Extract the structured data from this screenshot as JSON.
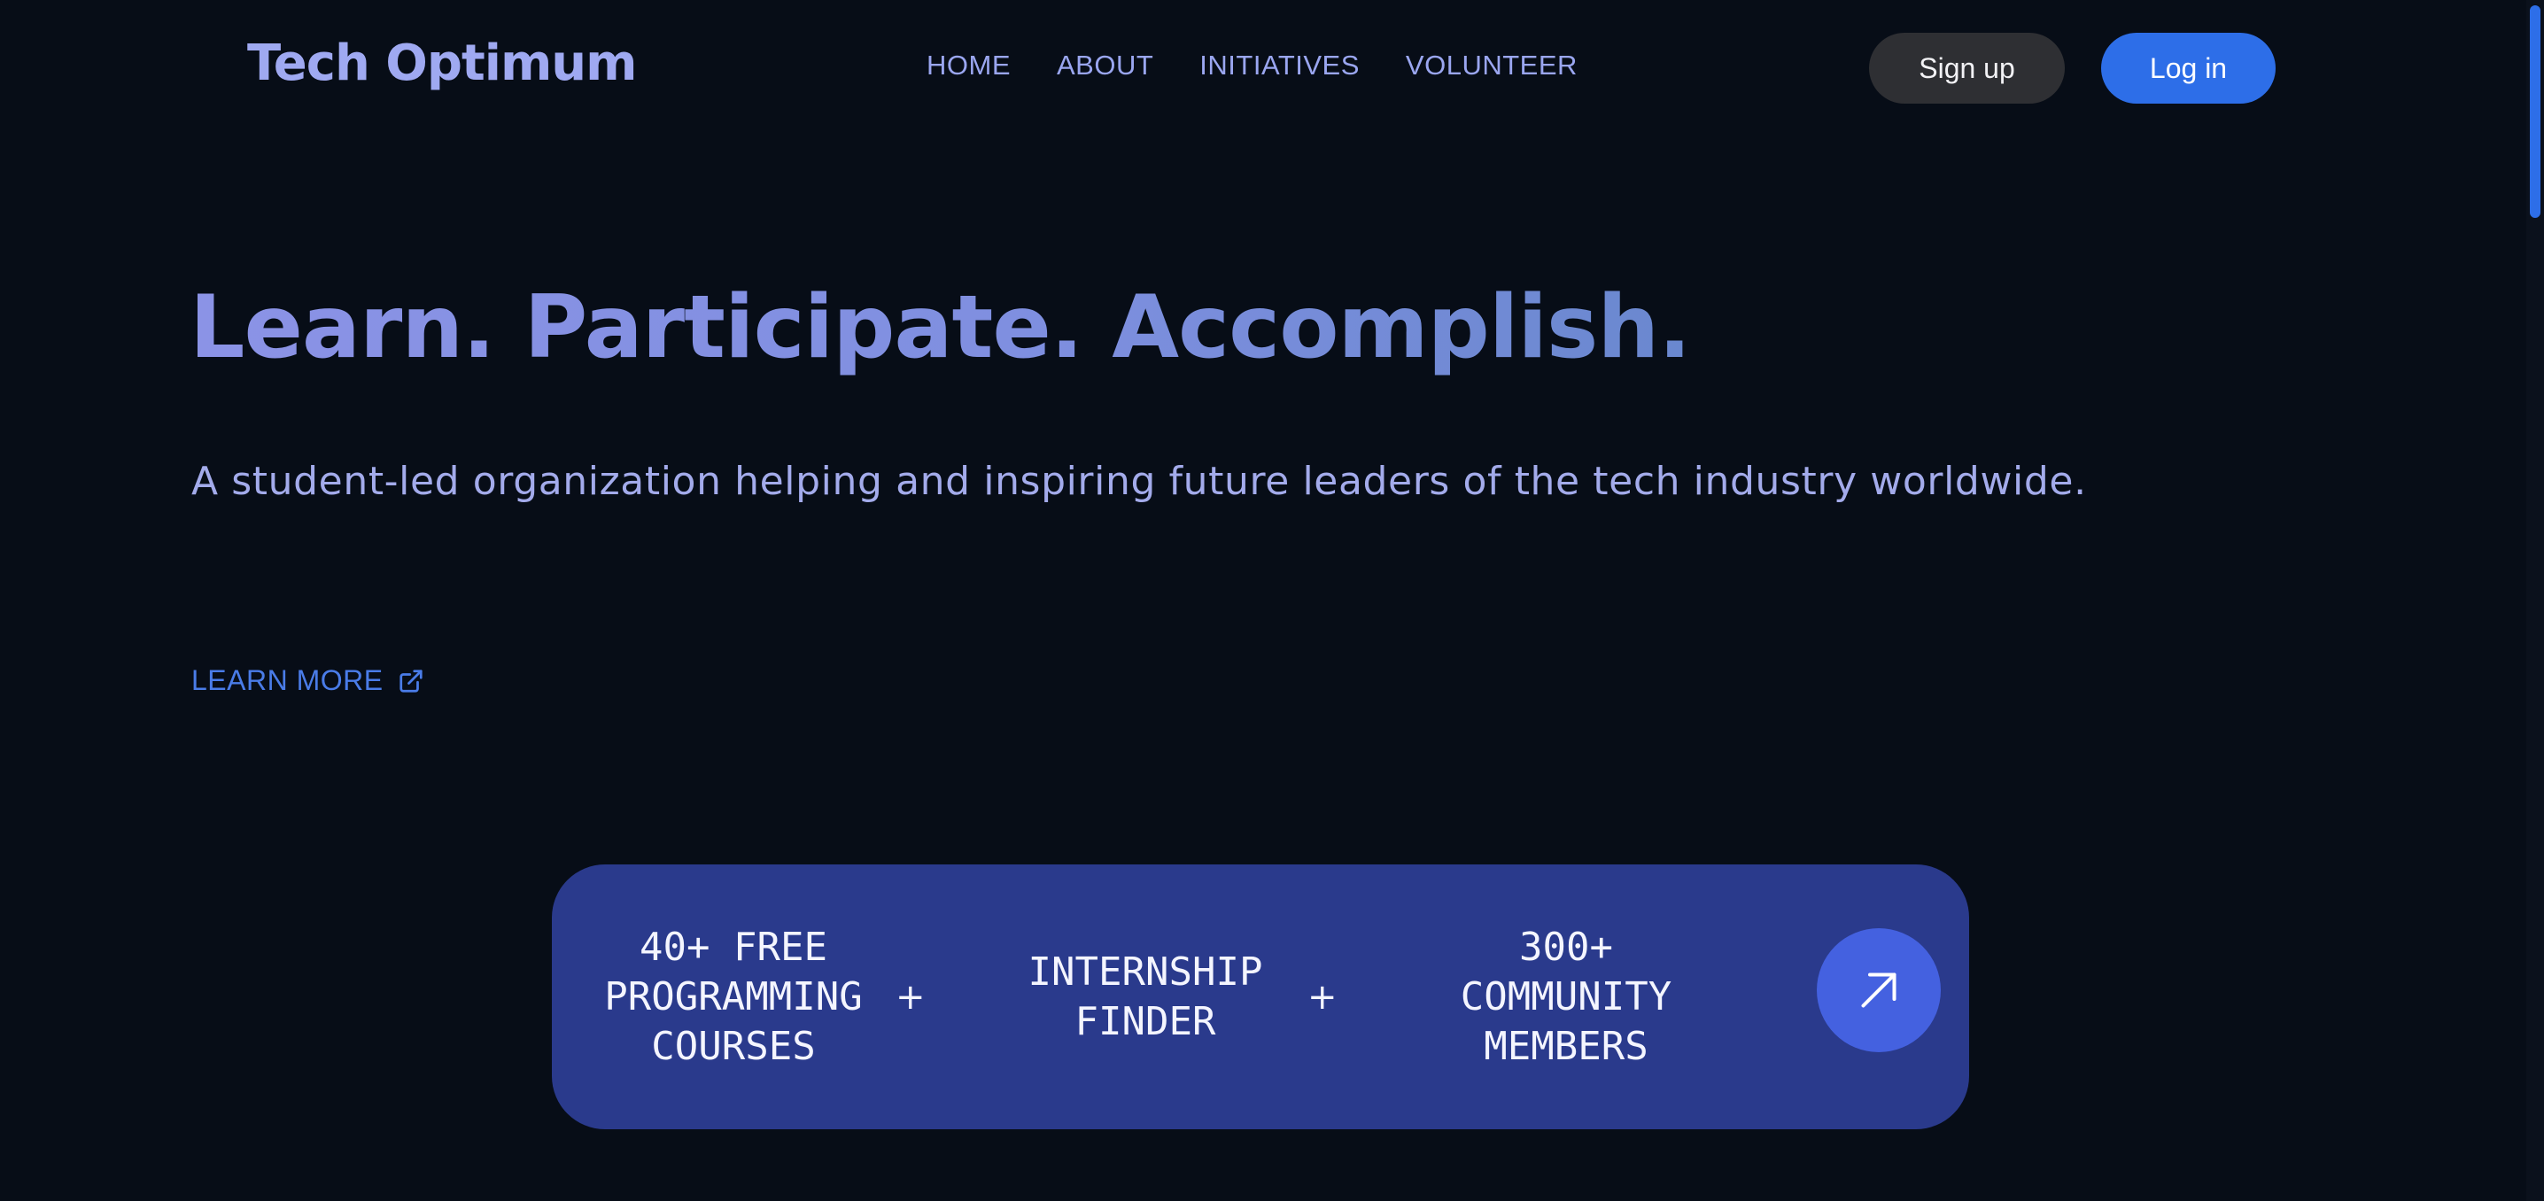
{
  "header": {
    "brand": "Tech Optimum",
    "nav": [
      "HOME",
      "ABOUT",
      "INITIATIVES",
      "VOLUNTEER"
    ],
    "signup_label": "Sign up",
    "login_label": "Log in"
  },
  "hero": {
    "title": "Learn. Participate. Accomplish.",
    "subtitle": "A student-led organization helping and inspiring future leaders of the tech industry worldwide.",
    "learn_more_label": "LEARN MORE",
    "learn_more_icon": "external-link-icon"
  },
  "stats": {
    "items": [
      "40+ FREE\nPROGRAMMING\nCOURSES",
      "INTERNSHIP\nFINDER",
      "300+\nCOMMUNITY\nMEMBERS"
    ],
    "separator": "+",
    "action_icon": "arrow-up-right-icon"
  },
  "colors": {
    "background": "#070d17",
    "brand_text": "#9fa9f1",
    "accent_blue": "#2d6ee8",
    "card_bg": "#2a3a8c",
    "card_button": "#4461e0",
    "signup_bg": "#2e2f33"
  }
}
